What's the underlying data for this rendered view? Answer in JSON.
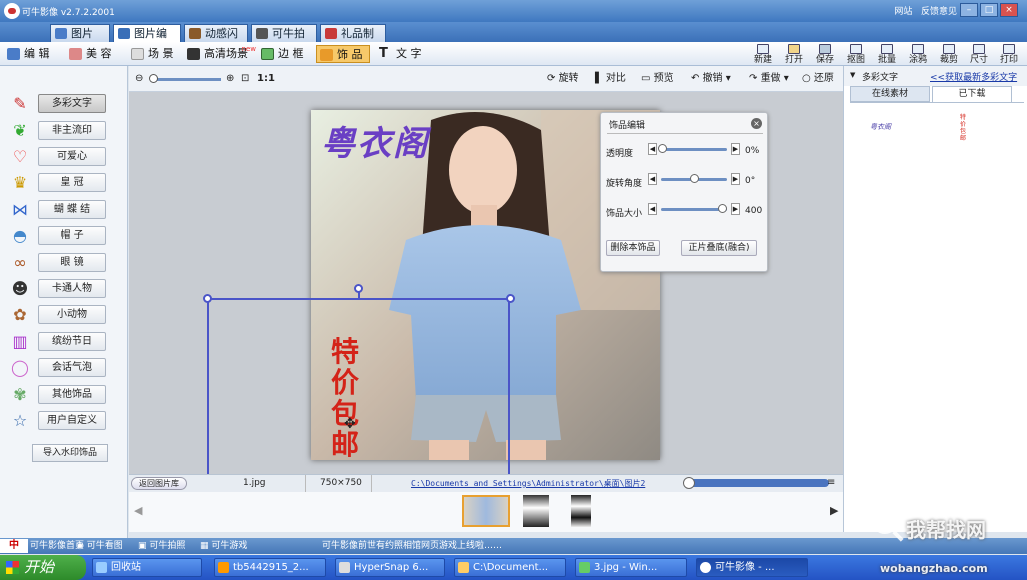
{
  "window": {
    "title": "可牛影像 v2.7.2.2001",
    "links": [
      "网站",
      "反馈意见"
    ]
  },
  "main_tabs": [
    "图片库",
    "图片编辑",
    "动感闪图",
    "可牛拍照",
    "礼品制作"
  ],
  "toolbar": {
    "items": [
      "编 辑",
      "美 容",
      "场 景",
      "高清场景",
      "边 框",
      "饰 品",
      "文 字"
    ],
    "new_badge": "new",
    "right": [
      "新建",
      "打开",
      "保存",
      "抠图",
      "批量",
      "涂鸦",
      "裁剪",
      "尺寸",
      "打印"
    ]
  },
  "left_panel": {
    "items": [
      "多彩文字",
      "非主流印",
      "可爱心",
      "皇 冠",
      "蝴 蝶 结",
      "帽 子",
      "眼 镜",
      "卡通人物",
      "小动物",
      "缤纷节日",
      "会话气泡",
      "其他饰品",
      "用户自定义"
    ],
    "import": "导入水印饰品"
  },
  "canvas_top": {
    "zoom_label": "1:1",
    "tools": [
      "旋转",
      "对比",
      "预览",
      "撤销",
      "重做",
      "还原"
    ]
  },
  "photo_text": {
    "top": "粤衣阁",
    "vertical": [
      "特",
      "价",
      "包",
      "邮"
    ]
  },
  "deco_panel": {
    "title": "饰品编辑",
    "rows": [
      {
        "label": "透明度",
        "value": "0%",
        "level": 0.02
      },
      {
        "label": "旋转角度",
        "value": "0°",
        "level": 0.5
      },
      {
        "label": "饰品大小",
        "value": "400",
        "level": 0.93
      }
    ],
    "delete": "删除本饰品",
    "merge": "正片叠底(融合)"
  },
  "status": {
    "back": "返回图片库",
    "filename": "1.jpg",
    "size": "750×750",
    "path": "C:\\Documents and Settings\\Administrator\\桌面\\图片2"
  },
  "right_panel": {
    "title": "多彩文字",
    "link": "<<获取最新多彩文字",
    "tabs": [
      "在线素材",
      "已下载"
    ],
    "thumb1": "粤衣阁",
    "thumb2": "特价包邮"
  },
  "bottom_nav": {
    "items": [
      "可牛影像首页",
      "可牛看图",
      "可牛拍照",
      "可牛游戏"
    ],
    "ime": "中",
    "message": "可牛影像前世有约照相馆网页游戏上线啦……"
  },
  "taskbar": {
    "start": "开始",
    "tasks": [
      "回收站",
      "tb5442915_2...",
      "HyperSnap 6...",
      "C:\\Document...",
      "3.jpg - Win...",
      "可牛影像 - ..."
    ],
    "watermark": "我帮找网",
    "watermark_url": "wobangzhao.com"
  }
}
